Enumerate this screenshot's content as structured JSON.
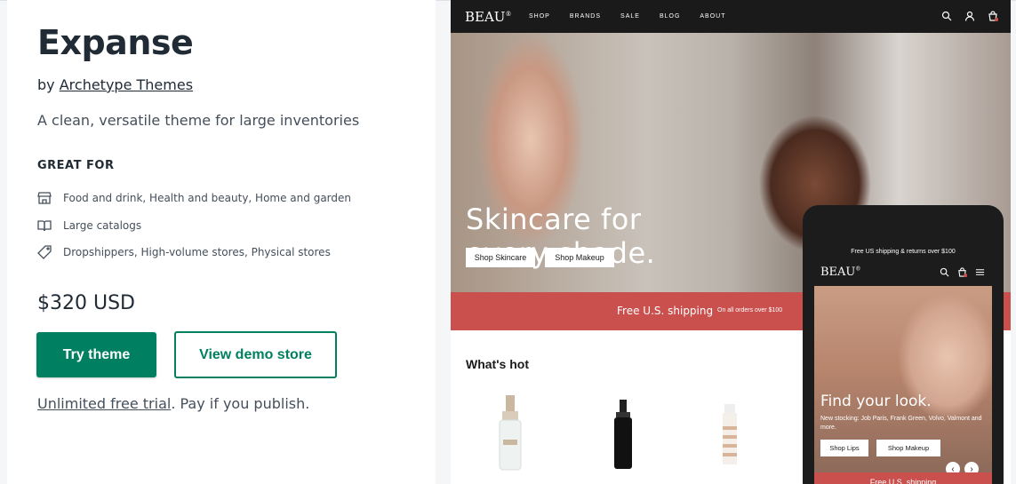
{
  "theme": {
    "name": "Expanse",
    "by_prefix": "by ",
    "author": "Archetype Themes",
    "tagline": "A clean, versatile theme for large inventories",
    "great_for_heading": "GREAT FOR",
    "features": [
      {
        "icon": "store-icon",
        "text": "Food and drink, Health and beauty, Home and garden"
      },
      {
        "icon": "book-icon",
        "text": "Large catalogs"
      },
      {
        "icon": "tag-icon",
        "text": "Dropshippers, High-volume stores, Physical stores"
      }
    ],
    "price": "$320 USD",
    "try_label": "Try theme",
    "demo_label": "View demo store",
    "trial_link": "Unlimited free trial",
    "trial_rest": ". Pay if you publish."
  },
  "preview": {
    "logo": "BEAU",
    "logo_mark": "®",
    "nav": [
      "SHOP",
      "BRANDS",
      "SALE",
      "BLOG",
      "ABOUT"
    ],
    "cart_count": "0",
    "hero_line1": "Skincare for",
    "hero_line2": "every shade.",
    "hero_btn1": "Shop Skincare",
    "hero_btn2": "Shop Makeup",
    "band_main": "Free U.S. shipping",
    "band_sub": "On all orders over $100",
    "whats_hot": "What's hot",
    "mobile": {
      "ship_bar": "Free US shipping & returns over $100",
      "logo": "BEAU",
      "cart_count": "0",
      "hero_title": "Find your look.",
      "hero_sub": "New stocking: Job Paris, Frank Green, Volvo, Valmont and more.",
      "btn1": "Shop Lips",
      "btn2": "Shop Makeup",
      "band": "Free U.S. shipping"
    }
  },
  "colors": {
    "primary": "#008060",
    "brand_band": "#c9504d",
    "dark": "#1a1a1a"
  }
}
